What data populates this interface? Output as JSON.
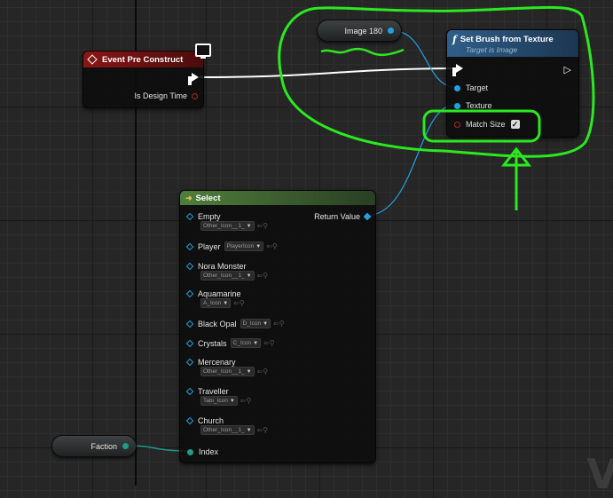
{
  "nodes": {
    "event_pre_construct": {
      "title": "Event Pre Construct",
      "pin_is_design_time": "Is Design Time"
    },
    "image_var": {
      "label": "Image 180"
    },
    "set_brush": {
      "title": "Set Brush from Texture",
      "subtitle": "Target is Image",
      "pin_target": "Target",
      "pin_texture": "Texture",
      "pin_match_size": "Match Size",
      "match_size_checked": true
    },
    "select": {
      "title": "Select",
      "return_value": "Return Value",
      "index_label": "Index",
      "options": [
        {
          "label": "Empty",
          "value": "Other_Icon__1_",
          "stacked": true
        },
        {
          "label": "Player",
          "value": "PlayerIcon",
          "stacked": false
        },
        {
          "label": "Nora Monster",
          "value": "Other_Icon__1_",
          "stacked": true
        },
        {
          "label": "Aquamarine",
          "value": "A_Icon",
          "stacked": true
        },
        {
          "label": "Black Opal",
          "value": "D_Icon",
          "stacked": false
        },
        {
          "label": "Crystals",
          "value": "C_Icon",
          "stacked": false
        },
        {
          "label": "Mercenary",
          "value": "Other_Icon__1_",
          "stacked": true
        },
        {
          "label": "Traveller",
          "value": "Tabi_Icon",
          "stacked": true
        },
        {
          "label": "Church",
          "value": "Other_Icon__1_",
          "stacked": true
        }
      ]
    },
    "faction_var": {
      "label": "Faction"
    }
  },
  "colors": {
    "event_header": "#7a1212",
    "function_header": "#2f5f8a",
    "select_header": "#4a7a3a",
    "annotation": "#2be81f",
    "object_pin": "#1fa3e0",
    "byte_pin": "#1d9b86",
    "bool_pin": "#b02424"
  },
  "icons": [
    "diamond-event-icon",
    "monitor-icon",
    "function-icon",
    "select-arrow-icon"
  ]
}
